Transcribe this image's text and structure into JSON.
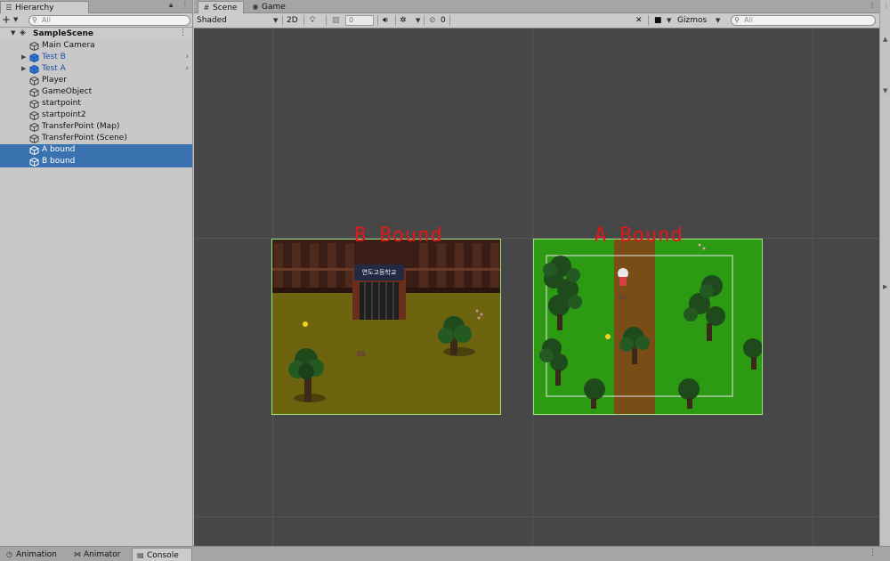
{
  "hierarchy": {
    "tab_label": "Hierarchy",
    "search_placeholder": "All",
    "scene_name": "SampleScene",
    "items": [
      {
        "label": "Main Camera",
        "prefab": false,
        "expandable": false,
        "selected": false
      },
      {
        "label": "Test B",
        "prefab": true,
        "expandable": true,
        "selected": false
      },
      {
        "label": "Test A",
        "prefab": true,
        "expandable": true,
        "selected": false
      },
      {
        "label": "Player",
        "prefab": false,
        "expandable": false,
        "selected": false
      },
      {
        "label": "GameObject",
        "prefab": false,
        "expandable": false,
        "selected": false
      },
      {
        "label": "startpoint",
        "prefab": false,
        "expandable": false,
        "selected": false
      },
      {
        "label": "startpoint2",
        "prefab": false,
        "expandable": false,
        "selected": false
      },
      {
        "label": "TransferPoint (Map)",
        "prefab": false,
        "expandable": false,
        "selected": false
      },
      {
        "label": "TransferPoint (Scene)",
        "prefab": false,
        "expandable": false,
        "selected": false
      },
      {
        "label": "A bound",
        "prefab": false,
        "expandable": false,
        "selected": true
      },
      {
        "label": "B bound",
        "prefab": false,
        "expandable": false,
        "selected": true
      }
    ]
  },
  "scene_view": {
    "tabs": [
      {
        "label": "Scene"
      },
      {
        "label": "Game"
      }
    ],
    "shading_mode": "Shaded",
    "mode_2d": "2D",
    "zoom_field": "0",
    "hidden_count": "0",
    "gizmos_label": "Gizmos",
    "search_placeholder": "All"
  },
  "maps": {
    "b_title": "B Bound",
    "a_title": "A Bound",
    "school_sign": "연도고등학교"
  },
  "bottom_tabs": [
    {
      "label": "Animation"
    },
    {
      "label": "Animator"
    },
    {
      "label": "Console"
    }
  ],
  "colors": {
    "selection": "#3a72b0",
    "prefab_text": "#1a4fa8",
    "bound_title": "#e01818",
    "viewport_bg": "#474747",
    "b_ground": "#6d6410",
    "a_grass": "#2c9a12",
    "a_path": "#7a4c16",
    "bound_outline": "#9ae07a"
  }
}
